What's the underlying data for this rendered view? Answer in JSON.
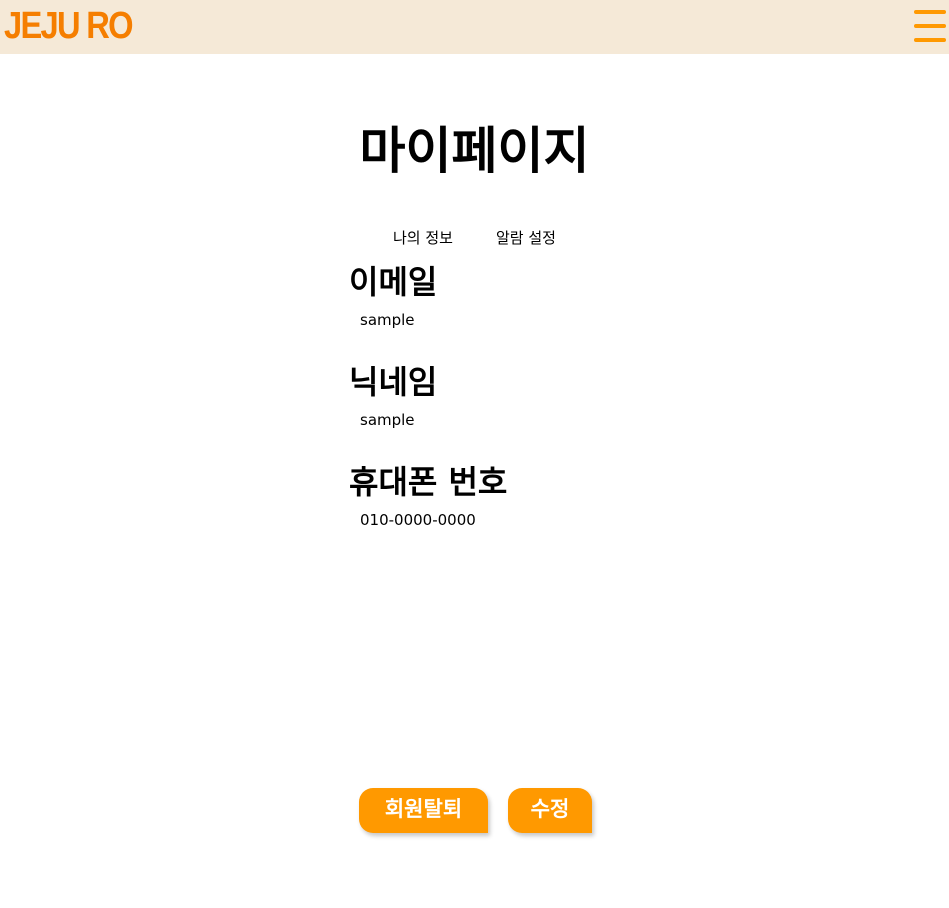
{
  "colors": {
    "header_bg": "#f5e9d7",
    "accent": "#f57e00",
    "button": "#ff9900"
  },
  "header": {
    "logo": "JEJU RO",
    "menu_icon": "hamburger-menu-icon"
  },
  "page": {
    "title": "마이페이지"
  },
  "tabs": [
    {
      "label": "나의 정보"
    },
    {
      "label": "알람 설정"
    }
  ],
  "fields": [
    {
      "label": "이메일",
      "value": "sample"
    },
    {
      "label": "닉네임",
      "value": "sample"
    },
    {
      "label": "휴대폰 번호",
      "value": "010-0000-0000"
    }
  ],
  "actions": {
    "withdraw_label": "회원탈퇴",
    "edit_label": "수정"
  }
}
